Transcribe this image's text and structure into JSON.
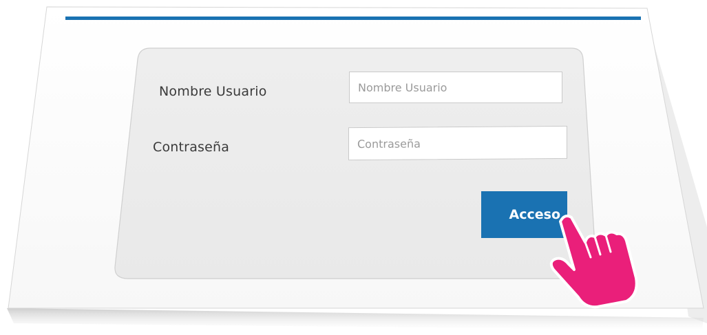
{
  "login": {
    "username_label": "Nombre Usuario",
    "username_placeholder": "Nombre Usuario",
    "password_label": "Contraseña",
    "password_placeholder": "Contraseña",
    "submit_label": "Acceso"
  },
  "colors": {
    "accent": "#1a72b2",
    "panel": "#ececec",
    "pointer": "#ea1f7a"
  },
  "icons": {
    "pointer": "pointing-hand-icon"
  }
}
